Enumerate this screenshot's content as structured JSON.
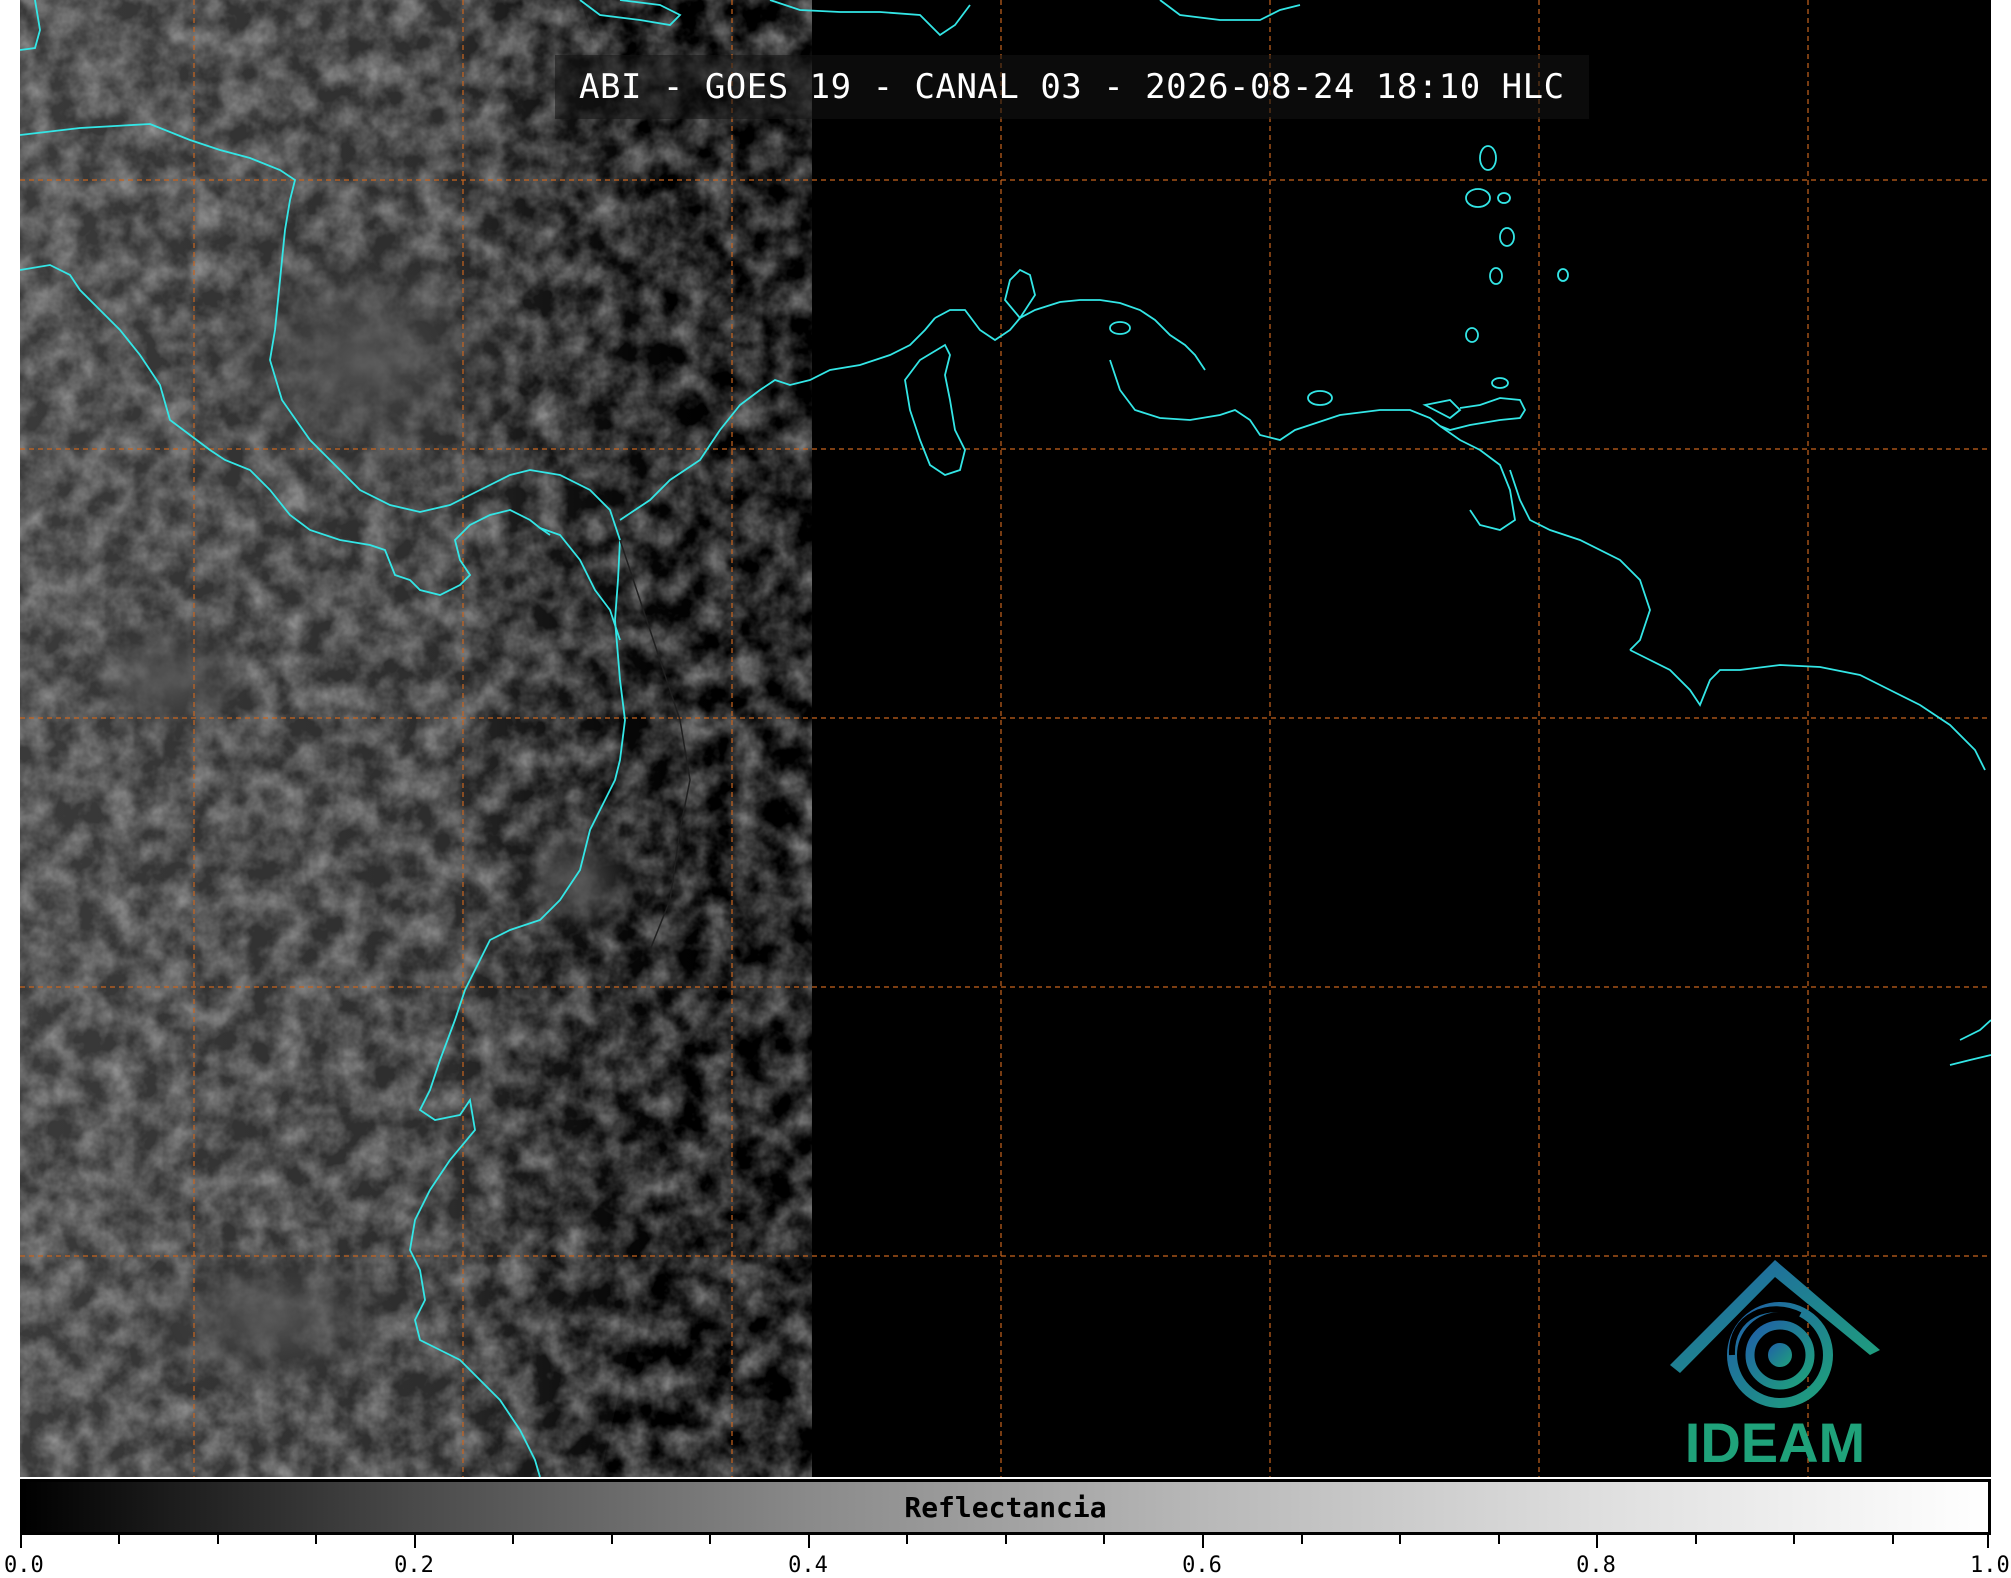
{
  "title": "ABI - GOES 19 - CANAL 03 - 2026-08-24 18:10 HLC",
  "logo": {
    "text": "IDEAM"
  },
  "colorbar": {
    "label": "Reflectancia",
    "ticks": [
      "0.0",
      "0.2",
      "0.4",
      "0.6",
      "0.8",
      "1.0"
    ],
    "range": [
      0.0,
      1.0
    ],
    "colormap": "grayscale"
  },
  "colors": {
    "coastline": "#33e6e6",
    "gridline": "#c8641e",
    "background": "#000000",
    "logo": "#1fa27a"
  }
}
